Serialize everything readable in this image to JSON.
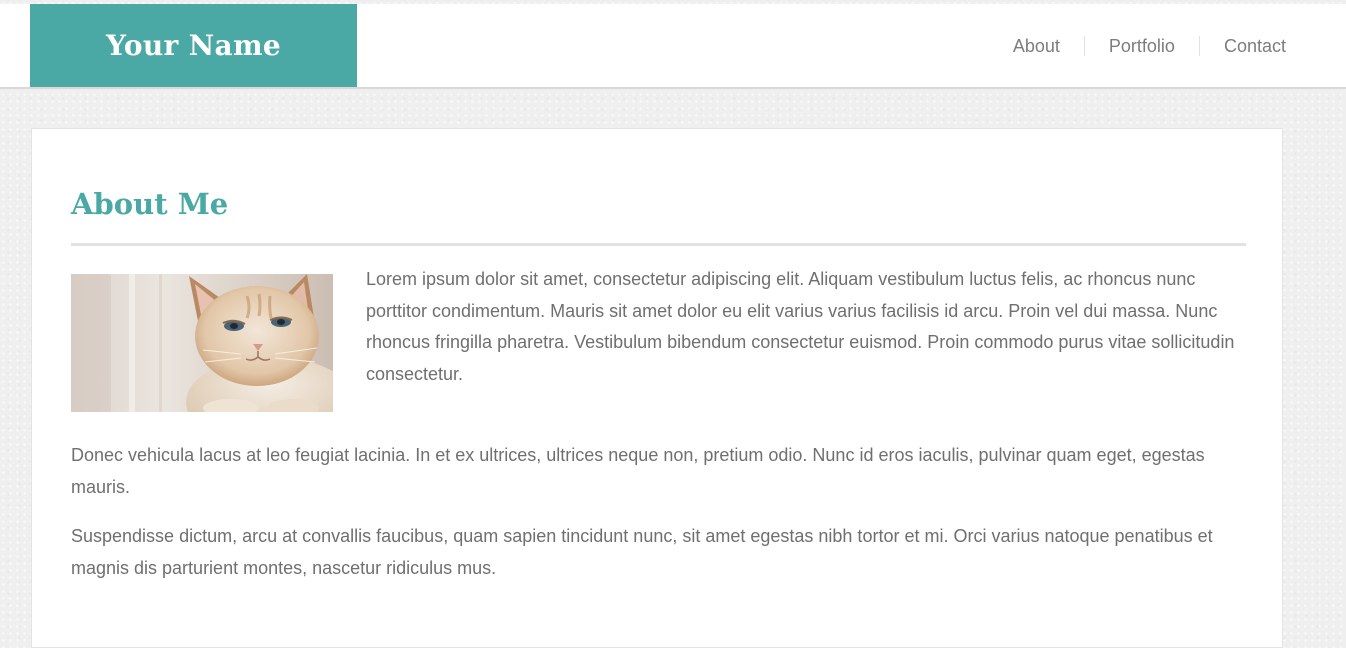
{
  "header": {
    "brand": "Your Name",
    "nav": [
      {
        "label": "About"
      },
      {
        "label": "Portfolio"
      },
      {
        "label": "Contact"
      }
    ]
  },
  "main": {
    "title": "About Me",
    "image_alt": "cat photo",
    "paragraphs": [
      "Lorem ipsum dolor sit amet, consectetur adipiscing elit. Aliquam vestibulum luctus felis, ac rhoncus nunc porttitor condimentum. Mauris sit amet dolor eu elit varius varius facilisis id arcu. Proin vel dui massa. Nunc rhoncus fringilla pharetra. Vestibulum bibendum consectetur euismod. Proin commodo purus vitae sollicitudin consectetur.",
      "Donec vehicula lacus at leo feugiat lacinia. In et ex ultrices, ultrices neque non, pretium odio. Nunc id eros iaculis, pulvinar quam eget, egestas mauris.",
      "Suspendisse dictum, arcu at convallis faucibus, quam sapien tincidunt nunc, sit amet egestas nibh tortor et mi. Orci varius natoque penatibus et magnis dis parturient montes, nascetur ridiculus mus."
    ]
  },
  "theme": {
    "accent": "#4aa9a4",
    "text": "#6f6f6f",
    "nav_text": "#7d7d7d",
    "background": "#efefef"
  }
}
